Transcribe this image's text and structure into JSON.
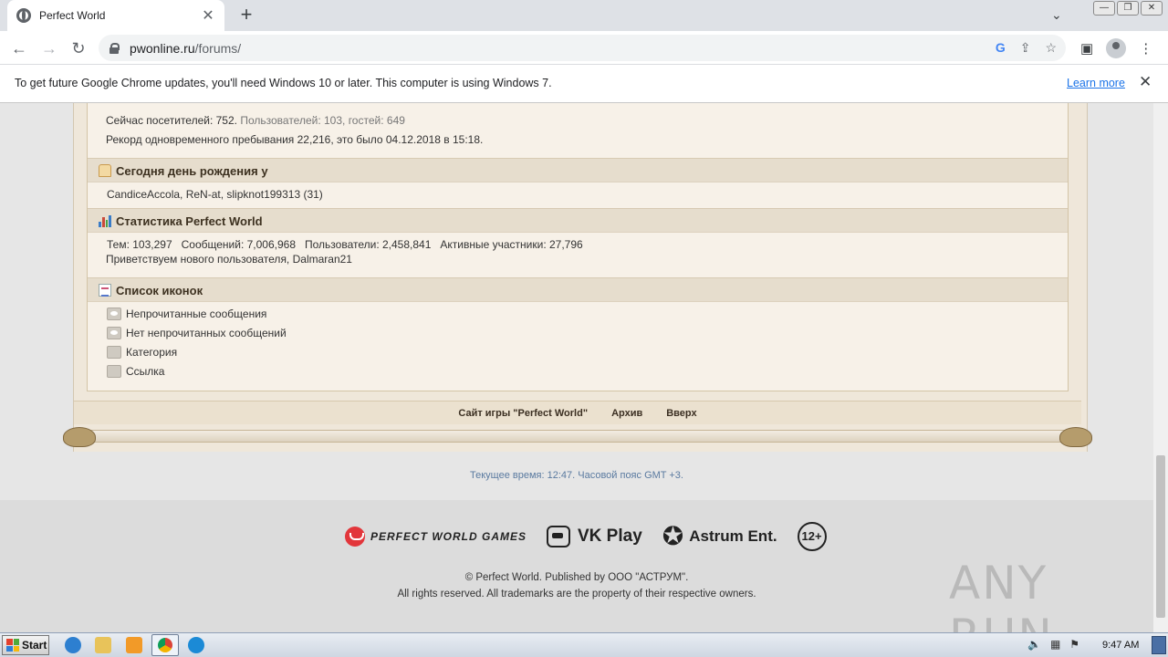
{
  "browser": {
    "tab_title": "Perfect World",
    "tab_close": "✕",
    "new_tab": "+",
    "url_host": "pwonline.ru",
    "url_path": "/forums/",
    "window_controls": [
      "—",
      "❐",
      "✕"
    ]
  },
  "infobar": {
    "message": "To get future Google Chrome updates, you'll need Windows 10 or later. This computer is using Windows 7.",
    "link": "Learn more",
    "close": "✕"
  },
  "forum": {
    "visitors_line": "Сейчас посетителей: 752.",
    "visitors_detail": "Пользователей: 103, гостей: 649",
    "record_line": "Рекорд одновременного пребывания 22,216, это было 04.12.2018 в 15:18.",
    "birthday": {
      "title": "Сегодня день рождения у",
      "names": "CandiceAccola, ReN-at, slipknot199313 (31)"
    },
    "statistics": {
      "title": "Статистика Perfect World",
      "line": "Тем: 103,297   Сообщений: 7,006,968   Пользователи: 2,458,841   Активные участники: 27,796",
      "welcome": "Приветствуем нового пользователя, Dalmaran21"
    },
    "icons_legend": {
      "title": "Список иконок",
      "items": [
        "Непрочитанные сообщения",
        "Нет непрочитанных сообщений",
        "Категория",
        "Ссылка"
      ]
    },
    "footer_links": [
      "Сайт игры \"Perfect World\"",
      "Архив",
      "Вверх"
    ],
    "time": "Текущее время: 12:47. Часовой пояс GMT +3."
  },
  "site_footer": {
    "logos": {
      "pw": "PERFECT WORLD GAMES",
      "vk": "VK Play",
      "astrum": "Astrum Ent.",
      "age": "12+"
    },
    "copyright": "© Perfect World. Published by ООО \"АСТРУМ\".",
    "rights": "All rights reserved. All trademarks are the property of their respective owners.",
    "watermark": "ANY RUN"
  },
  "taskbar": {
    "start": "Start",
    "clock": "9:47 AM"
  }
}
